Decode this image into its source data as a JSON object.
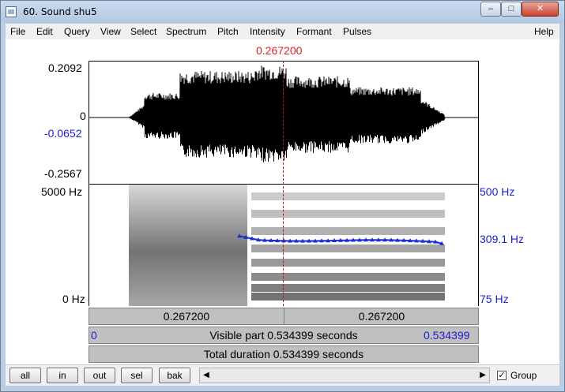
{
  "window": {
    "title": "60. Sound shu5"
  },
  "menu": [
    "File",
    "Edit",
    "Query",
    "View",
    "Select",
    "Spectrum",
    "Pitch",
    "Intensity",
    "Formant",
    "Pulses"
  ],
  "menu_help": "Help",
  "cursor_time": "0.267200",
  "waveform": {
    "max_label": "0.2092",
    "zero_label": "0",
    "cursor_value": "-0.0652",
    "min_label": "-0.2567"
  },
  "spectrogram": {
    "top_freq": "5000 Hz",
    "bottom_freq": "0 Hz"
  },
  "pitch": {
    "top": "500 Hz",
    "value": "309.1 Hz",
    "bottom": "75 Hz",
    "color": "#1c2ed8"
  },
  "time_bar": {
    "left": "0.267200",
    "right": "0.267200"
  },
  "visible_bar": {
    "start": "0",
    "text": "Visible part 0.534399 seconds",
    "end": "0.534399"
  },
  "total_bar": {
    "text": "Total duration 0.534399 seconds"
  },
  "buttons": {
    "all": "all",
    "in": "in",
    "out": "out",
    "sel": "sel",
    "bak": "bak"
  },
  "group": {
    "label": "Group",
    "checked": true
  }
}
